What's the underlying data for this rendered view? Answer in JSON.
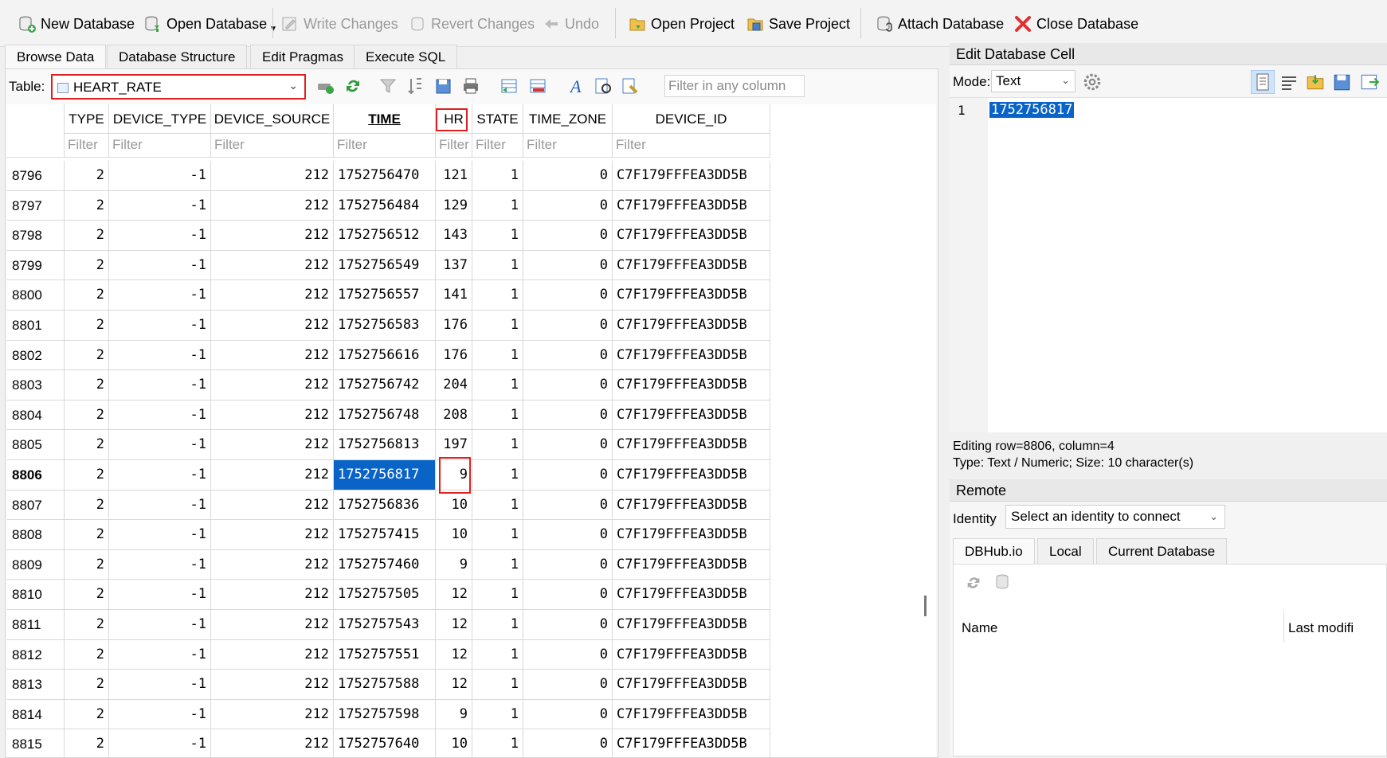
{
  "toolbar": {
    "new_database": "New Database",
    "open_database": "Open Database",
    "write_changes": "Write Changes",
    "revert_changes": "Revert Changes",
    "undo": "Undo",
    "open_project": "Open Project",
    "save_project": "Save Project",
    "attach_database": "Attach Database",
    "close_database": "Close Database"
  },
  "tabs": [
    "Browse Data",
    "Database Structure",
    "Edit Pragmas",
    "Execute SQL"
  ],
  "browse": {
    "table_label": "Table:",
    "table_value": "HEART_RATE",
    "filter_any_placeholder": "Filter in any column",
    "filter_placeholder": "Filter"
  },
  "grid": {
    "columns": [
      "TYPE",
      "DEVICE_TYPE",
      "DEVICE_SOURCE",
      "TIME",
      "HR",
      "STATE",
      "TIME_ZONE",
      "DEVICE_ID"
    ],
    "rows": [
      {
        "id": "8796",
        "cells": [
          "2",
          "-1",
          "212",
          "1752756470",
          "121",
          "1",
          "0",
          "C7F179FFFEA3DD5B"
        ]
      },
      {
        "id": "8797",
        "cells": [
          "2",
          "-1",
          "212",
          "1752756484",
          "129",
          "1",
          "0",
          "C7F179FFFEA3DD5B"
        ]
      },
      {
        "id": "8798",
        "cells": [
          "2",
          "-1",
          "212",
          "1752756512",
          "143",
          "1",
          "0",
          "C7F179FFFEA3DD5B"
        ]
      },
      {
        "id": "8799",
        "cells": [
          "2",
          "-1",
          "212",
          "1752756549",
          "137",
          "1",
          "0",
          "C7F179FFFEA3DD5B"
        ]
      },
      {
        "id": "8800",
        "cells": [
          "2",
          "-1",
          "212",
          "1752756557",
          "141",
          "1",
          "0",
          "C7F179FFFEA3DD5B"
        ]
      },
      {
        "id": "8801",
        "cells": [
          "2",
          "-1",
          "212",
          "1752756583",
          "176",
          "1",
          "0",
          "C7F179FFFEA3DD5B"
        ]
      },
      {
        "id": "8802",
        "cells": [
          "2",
          "-1",
          "212",
          "1752756616",
          "176",
          "1",
          "0",
          "C7F179FFFEA3DD5B"
        ]
      },
      {
        "id": "8803",
        "cells": [
          "2",
          "-1",
          "212",
          "1752756742",
          "204",
          "1",
          "0",
          "C7F179FFFEA3DD5B"
        ]
      },
      {
        "id": "8804",
        "cells": [
          "2",
          "-1",
          "212",
          "1752756748",
          "208",
          "1",
          "0",
          "C7F179FFFEA3DD5B"
        ]
      },
      {
        "id": "8805",
        "cells": [
          "2",
          "-1",
          "212",
          "1752756813",
          "197",
          "1",
          "0",
          "C7F179FFFEA3DD5B"
        ]
      },
      {
        "id": "8806",
        "cells": [
          "2",
          "-1",
          "212",
          "1752756817",
          "9",
          "1",
          "0",
          "C7F179FFFEA3DD5B"
        ]
      },
      {
        "id": "8807",
        "cells": [
          "2",
          "-1",
          "212",
          "1752756836",
          "10",
          "1",
          "0",
          "C7F179FFFEA3DD5B"
        ]
      },
      {
        "id": "8808",
        "cells": [
          "2",
          "-1",
          "212",
          "1752757415",
          "10",
          "1",
          "0",
          "C7F179FFFEA3DD5B"
        ]
      },
      {
        "id": "8809",
        "cells": [
          "2",
          "-1",
          "212",
          "1752757460",
          "9",
          "1",
          "0",
          "C7F179FFFEA3DD5B"
        ]
      },
      {
        "id": "8810",
        "cells": [
          "2",
          "-1",
          "212",
          "1752757505",
          "12",
          "1",
          "0",
          "C7F179FFFEA3DD5B"
        ]
      },
      {
        "id": "8811",
        "cells": [
          "2",
          "-1",
          "212",
          "1752757543",
          "12",
          "1",
          "0",
          "C7F179FFFEA3DD5B"
        ]
      },
      {
        "id": "8812",
        "cells": [
          "2",
          "-1",
          "212",
          "1752757551",
          "12",
          "1",
          "0",
          "C7F179FFFEA3DD5B"
        ]
      },
      {
        "id": "8813",
        "cells": [
          "2",
          "-1",
          "212",
          "1752757588",
          "12",
          "1",
          "0",
          "C7F179FFFEA3DD5B"
        ]
      },
      {
        "id": "8814",
        "cells": [
          "2",
          "-1",
          "212",
          "1752757598",
          "9",
          "1",
          "0",
          "C7F179FFFEA3DD5B"
        ]
      },
      {
        "id": "8815",
        "cells": [
          "2",
          "-1",
          "212",
          "1752757640",
          "10",
          "1",
          "0",
          "C7F179FFFEA3DD5B"
        ]
      }
    ]
  },
  "edit_cell": {
    "title": "Edit Database Cell",
    "mode_label": "Mode:",
    "mode_value": "Text",
    "line_number": "1",
    "content": "1752756817",
    "info_line1": "Editing row=8806, column=4",
    "info_line2": "Type: Text / Numeric; Size: 10 character(s)"
  },
  "remote": {
    "title": "Remote",
    "identity_label": "Identity",
    "identity_placeholder": "Select an identity to connect",
    "tabs": [
      "DBHub.io",
      "Local",
      "Current Database"
    ],
    "col_name": "Name",
    "col_last_modified": "Last modifi"
  },
  "colors": {
    "selection": "#0a64c8",
    "highlight_box": "#e02020",
    "close_icon": "#e03030"
  }
}
